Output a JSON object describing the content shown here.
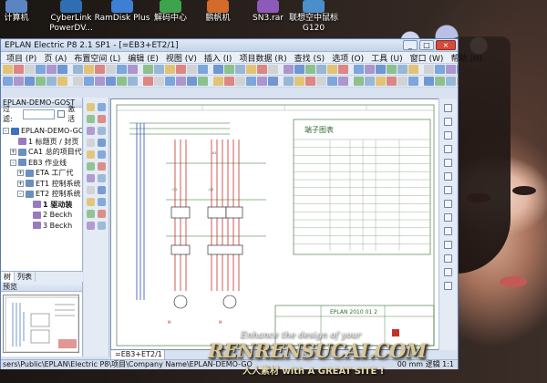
{
  "desktop": {
    "icons": [
      {
        "label": "计算机",
        "color": "#5b85c2"
      },
      {
        "label": "CyberLink PowerDV...",
        "color": "#2f6fb1"
      },
      {
        "label": "RamDisk Plus",
        "color": "#3c7fd3"
      },
      {
        "label": "解码中心",
        "color": "#3fa34d"
      },
      {
        "label": "鹏帆机",
        "color": "#d36b2a"
      },
      {
        "label": "SN3.rar",
        "color": "#8c5ab8"
      },
      {
        "label": "联想空中鼠标 G120",
        "color": "#4a8fcb"
      }
    ]
  },
  "window": {
    "title": "EPLAN Electric P8 2.1 SP1 - [=EB3+ET2/1]",
    "buttons": {
      "minimize": "_",
      "maximize": "□",
      "close": "×"
    }
  },
  "menu": {
    "items": [
      "项目 (P)",
      "页 (A)",
      "布置空间 (L)",
      "编辑 (E)",
      "视图 (V)",
      "插入 (I)",
      "项目数据 (R)",
      "查找 (S)",
      "选项 (O)",
      "工具 (U)",
      "窗口 (W)",
      "帮助 (H)"
    ]
  },
  "pages_pane": {
    "title": "EPLAN-DEMO-GOST",
    "filter_label": "过滤:",
    "activate_label": "激活",
    "tree": [
      {
        "label": "EPLAN-DEMO-GO",
        "level": 0,
        "kind": "root",
        "expander": "-"
      },
      {
        "label": "1 标题页 / 封页",
        "level": 1,
        "kind": "page",
        "expander": ""
      },
      {
        "label": "CA1 总的项目代",
        "level": 1,
        "kind": "folder",
        "expander": "+"
      },
      {
        "label": "EB3 作业线",
        "level": 1,
        "kind": "folder",
        "expander": "-"
      },
      {
        "label": "ETA 工厂代",
        "level": 2,
        "kind": "folder",
        "expander": "+"
      },
      {
        "label": "ET1 控制系统",
        "level": 2,
        "kind": "folder",
        "expander": "+"
      },
      {
        "label": "ET2 控制系统",
        "level": 2,
        "kind": "folder",
        "expander": "-"
      },
      {
        "label": "1 驱动装",
        "level": 3,
        "kind": "page",
        "expander": "",
        "bold": true
      },
      {
        "label": "2 Beckh",
        "level": 3,
        "kind": "page",
        "expander": ""
      },
      {
        "label": "3 Beckh",
        "level": 3,
        "kind": "page",
        "expander": ""
      }
    ],
    "tabs": [
      "树",
      "列表"
    ]
  },
  "preview_pane": {
    "title": "预览"
  },
  "drawing": {
    "terminal_chart_title": "端子图表",
    "titleblock_text": "EPLAN 2010 01 2",
    "sheet_tab": "=EB3+ET2/1"
  },
  "statusbar": {
    "path": "sers\\Public\\EPLAN\\Electric P8\\项目\\Company Name\\EPLAN-DEMO-GO",
    "right": "00 mm    逻辑 1:1"
  },
  "watermark": {
    "tagline": "Enhance the design of your",
    "brand": "RENRENSUCAI.COM",
    "sub": "人人素材 with A GREAT SITE !"
  },
  "colors": {
    "window_bg": "#d8e2f0",
    "titlebar": "#c3d4ea",
    "schematic_line": "#2f6b2f",
    "schematic_red": "#c4302b",
    "schematic_blue": "#2b4fc4"
  }
}
